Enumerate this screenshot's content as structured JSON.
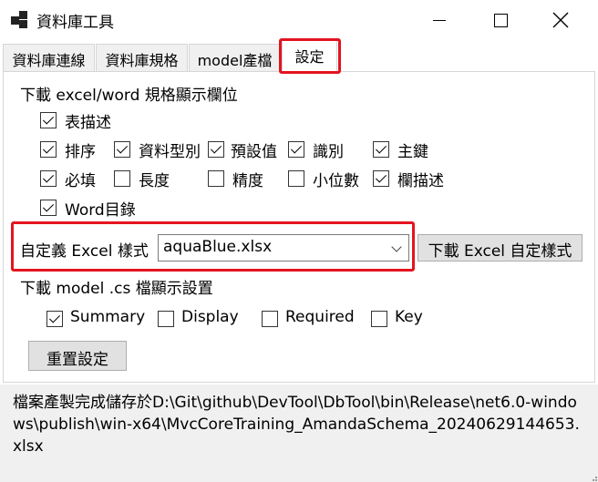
{
  "window": {
    "title": "資料庫工具"
  },
  "tabs": [
    {
      "label": "資料庫連線"
    },
    {
      "label": "資料庫規格"
    },
    {
      "label": "model產檔"
    },
    {
      "label": "設定"
    }
  ],
  "settings": {
    "excel_section_label": "下載 excel/word 規格顯示欄位",
    "options": [
      {
        "label": "表描述",
        "checked": true
      },
      {
        "label": "排序",
        "checked": true
      },
      {
        "label": "資料型別",
        "checked": true
      },
      {
        "label": "預設值",
        "checked": true
      },
      {
        "label": "識別",
        "checked": true
      },
      {
        "label": "主鍵",
        "checked": true
      },
      {
        "label": "必填",
        "checked": true
      },
      {
        "label": "長度",
        "checked": false
      },
      {
        "label": "精度",
        "checked": false
      },
      {
        "label": "小位數",
        "checked": false
      },
      {
        "label": "欄描述",
        "checked": true
      },
      {
        "label": "Word目錄",
        "checked": true
      }
    ],
    "custom_style_label": "自定義 Excel 樣式",
    "custom_style_value": "aquaBlue.xlsx",
    "download_style_button": "下載 Excel 自定樣式",
    "model_section_label": "下載 model .cs 檔顯示設置",
    "model_options": [
      {
        "label": "Summary",
        "checked": true
      },
      {
        "label": "Display",
        "checked": false
      },
      {
        "label": "Required",
        "checked": false
      },
      {
        "label": "Key",
        "checked": false
      }
    ],
    "reset_button": "重置設定"
  },
  "status": {
    "message": "檔案產製完成儲存於D:\\Git\\github\\DevTool\\DbTool\\bin\\Release\\net6.0-windows\\publish\\win-x64\\MvcCoreTraining_AmandaSchema_20240629144653.xlsx"
  },
  "colors": {
    "highlight": "#e3141f",
    "button_bg": "#e1e1e1",
    "status_bg": "#f0f0f0"
  }
}
